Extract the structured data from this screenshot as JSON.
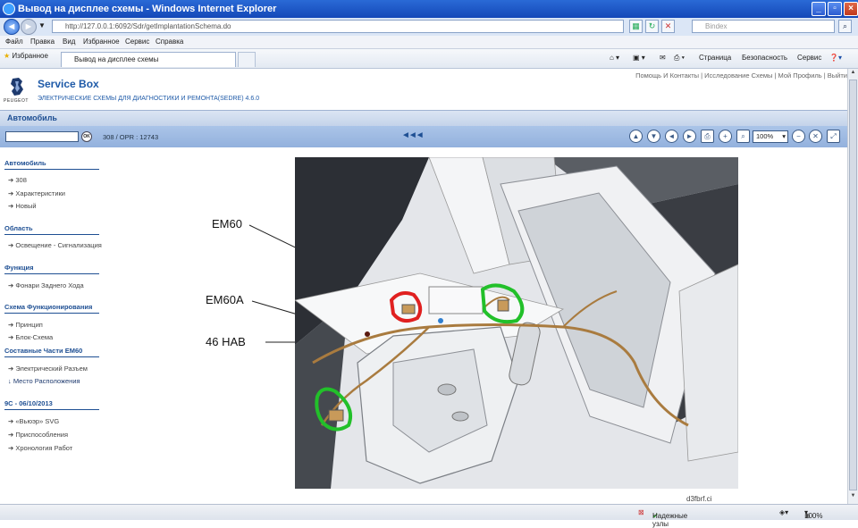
{
  "window": {
    "title": "Вывод на дисплее схемы - Windows Internet Explorer"
  },
  "address": {
    "url": "http://127.0.0.1:6092/Sdr/getImplantationSchema.do",
    "search_placeholder": "Bindex"
  },
  "menu": {
    "items": [
      "Файл",
      "Правка",
      "Вид",
      "Избранное",
      "Сервис",
      "Справка"
    ]
  },
  "favorites": {
    "label": "Избранное",
    "tab_title": "Вывод на дисплее схемы",
    "commands": [
      "Страница",
      "Безопасность",
      "Сервис"
    ]
  },
  "app": {
    "brand": "PEUGEOT",
    "title": "Service Box",
    "subtitle": "ЭЛЕКТРИЧЕСКИЕ СХЕМЫ ДЛЯ ДИАГНОСТИКИ И РЕМОНТА(SEDRE) 4.6.0",
    "top_links": "Помощь И Контакты | Исследование Схемы | Мой Профиль | Выйти"
  },
  "section": {
    "title": "Автомобиль"
  },
  "toolbar": {
    "ok": "OK",
    "code": "308  /  OPR : 12743",
    "rewind": "◄◄◄",
    "zoom": "100%"
  },
  "sidebar": {
    "groups": [
      {
        "title": "Автомобиль",
        "items": [
          "308",
          "Характеристики",
          "Новый"
        ]
      },
      {
        "title": "Область",
        "items": [
          "Освещение - Сигнализация"
        ]
      },
      {
        "title": "Функция",
        "items": [
          "Фонари Заднего Хода"
        ]
      },
      {
        "title": "Схема Функционирования",
        "items": [
          "Принцип",
          "Блок-Схема"
        ]
      },
      {
        "title": "Составные Части EM60",
        "items": [
          "Электрический Разъем",
          "Место Расположения"
        ]
      },
      {
        "title": "9C - 06/10/2013",
        "items": [
          "«Вьюэр» SVG",
          "Приспособления",
          "Хронология Работ"
        ]
      }
    ]
  },
  "diagram": {
    "callouts": [
      "EM60",
      "EM60A",
      "46 HAB"
    ]
  },
  "footer_fragment": "d3fbrf.ci",
  "statusbar": {
    "zone": "Надежные узлы",
    "zoom": "100%"
  }
}
